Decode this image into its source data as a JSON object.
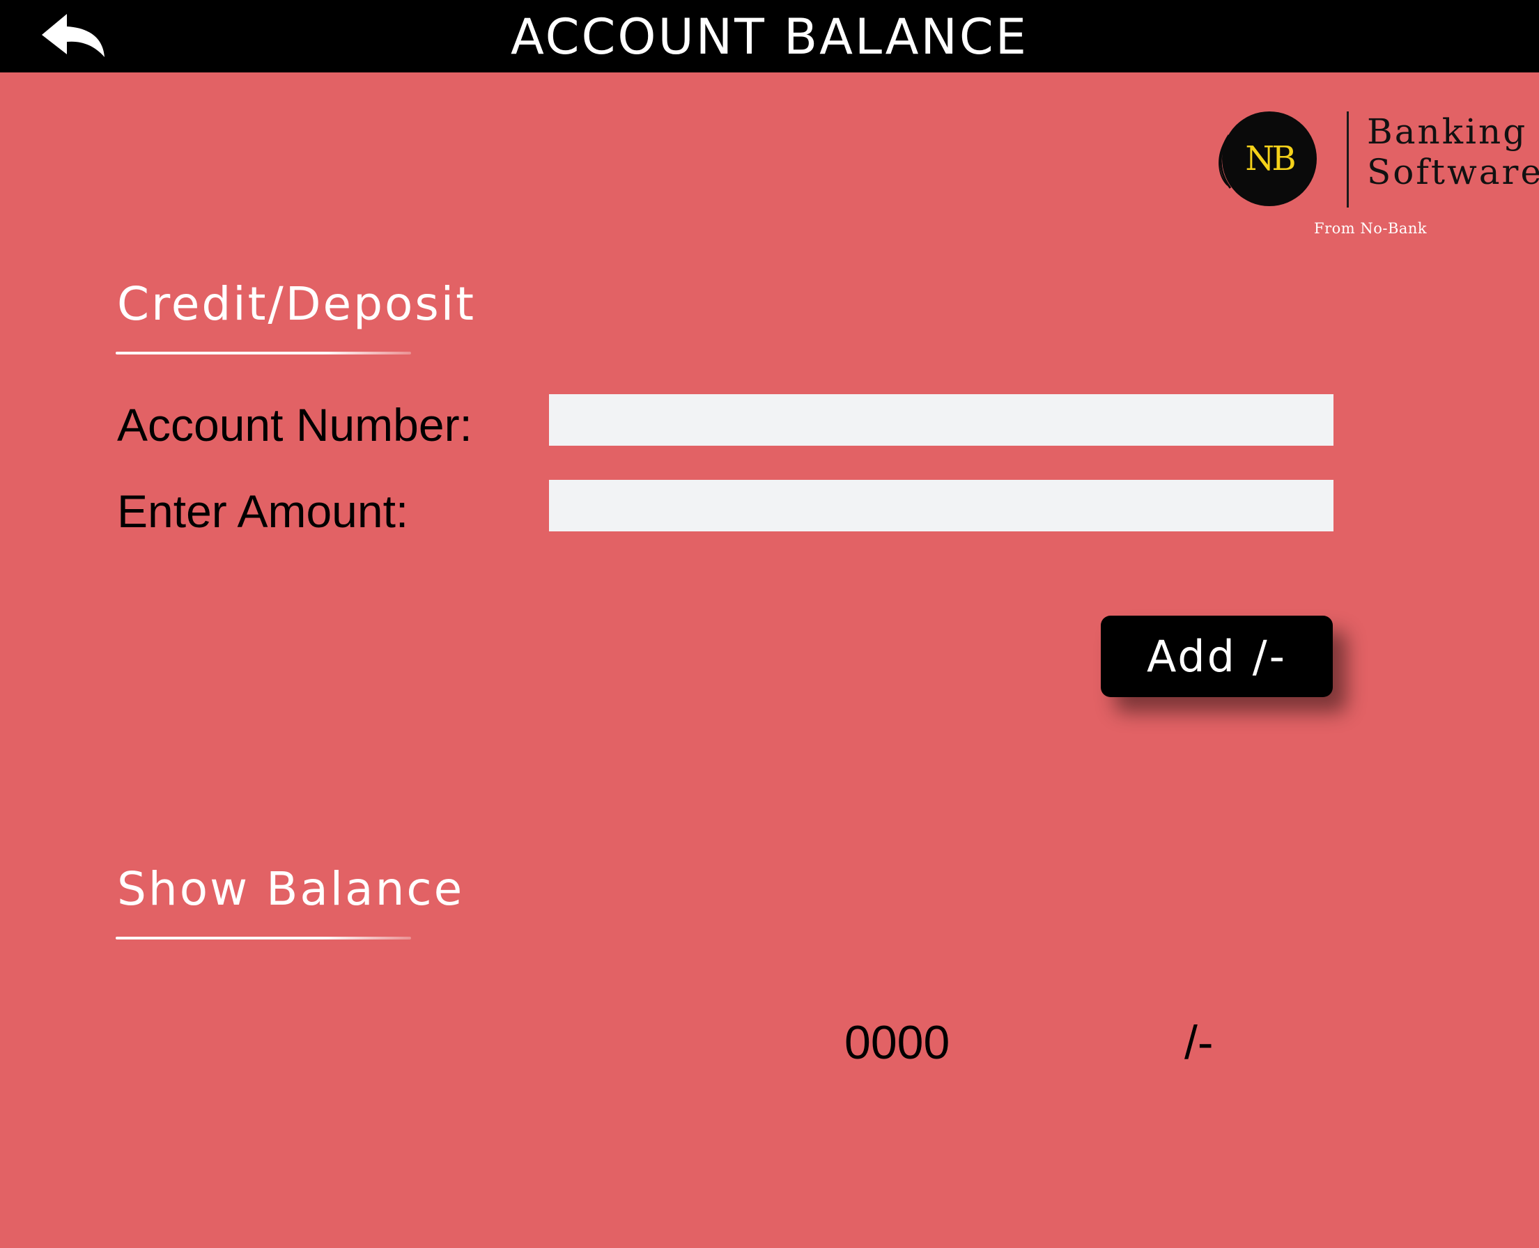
{
  "header": {
    "title": "ACCOUNT BALANCE",
    "back_icon": "back-arrow-icon"
  },
  "logo": {
    "monogram": "NB",
    "line1": "Banking",
    "line2": "Software",
    "tagline": "From No-Bank",
    "colors": {
      "circle": "#0a0a0a",
      "monogram": "#f5d21a"
    }
  },
  "credit_section": {
    "title": "Credit/Deposit",
    "account_label": "Account Number:",
    "account_value": "",
    "amount_label": "Enter Amount:",
    "amount_value": "",
    "add_button": "Add /-"
  },
  "balance_section": {
    "title": "Show Balance",
    "value": "0000",
    "suffix": "/-"
  },
  "colors": {
    "background": "#e26265",
    "header_bar": "#000000",
    "input_fill": "#f2f3f5",
    "button": "#000000"
  }
}
